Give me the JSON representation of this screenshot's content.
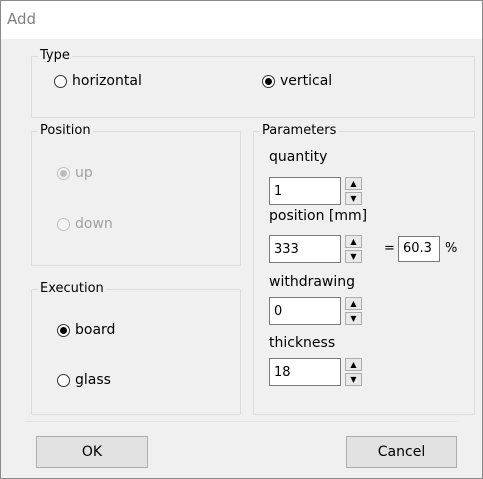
{
  "window": {
    "title": "Add"
  },
  "type_group": {
    "label": "Type",
    "options": [
      {
        "label": "horizontal",
        "checked": false
      },
      {
        "label": "vertical",
        "checked": true
      }
    ]
  },
  "position_group": {
    "label": "Position",
    "enabled": false,
    "options": [
      {
        "label": "up",
        "checked": true
      },
      {
        "label": "down",
        "checked": false
      }
    ]
  },
  "execution_group": {
    "label": "Execution",
    "options": [
      {
        "label": "board",
        "checked": true
      },
      {
        "label": "glass",
        "checked": false
      }
    ]
  },
  "parameters_group": {
    "label": "Parameters",
    "quantity": {
      "label": "quantity",
      "value": "1"
    },
    "position": {
      "label": "position [mm]",
      "value": "333",
      "equals": "=",
      "percent_value": "60.3",
      "percent_unit": "%"
    },
    "withdrawing": {
      "label": "withdrawing",
      "value": "0"
    },
    "thickness": {
      "label": "thickness",
      "value": "18"
    },
    "spin_up_glyph": "▲",
    "spin_down_glyph": "▼"
  },
  "buttons": {
    "ok": "OK",
    "cancel": "Cancel"
  }
}
